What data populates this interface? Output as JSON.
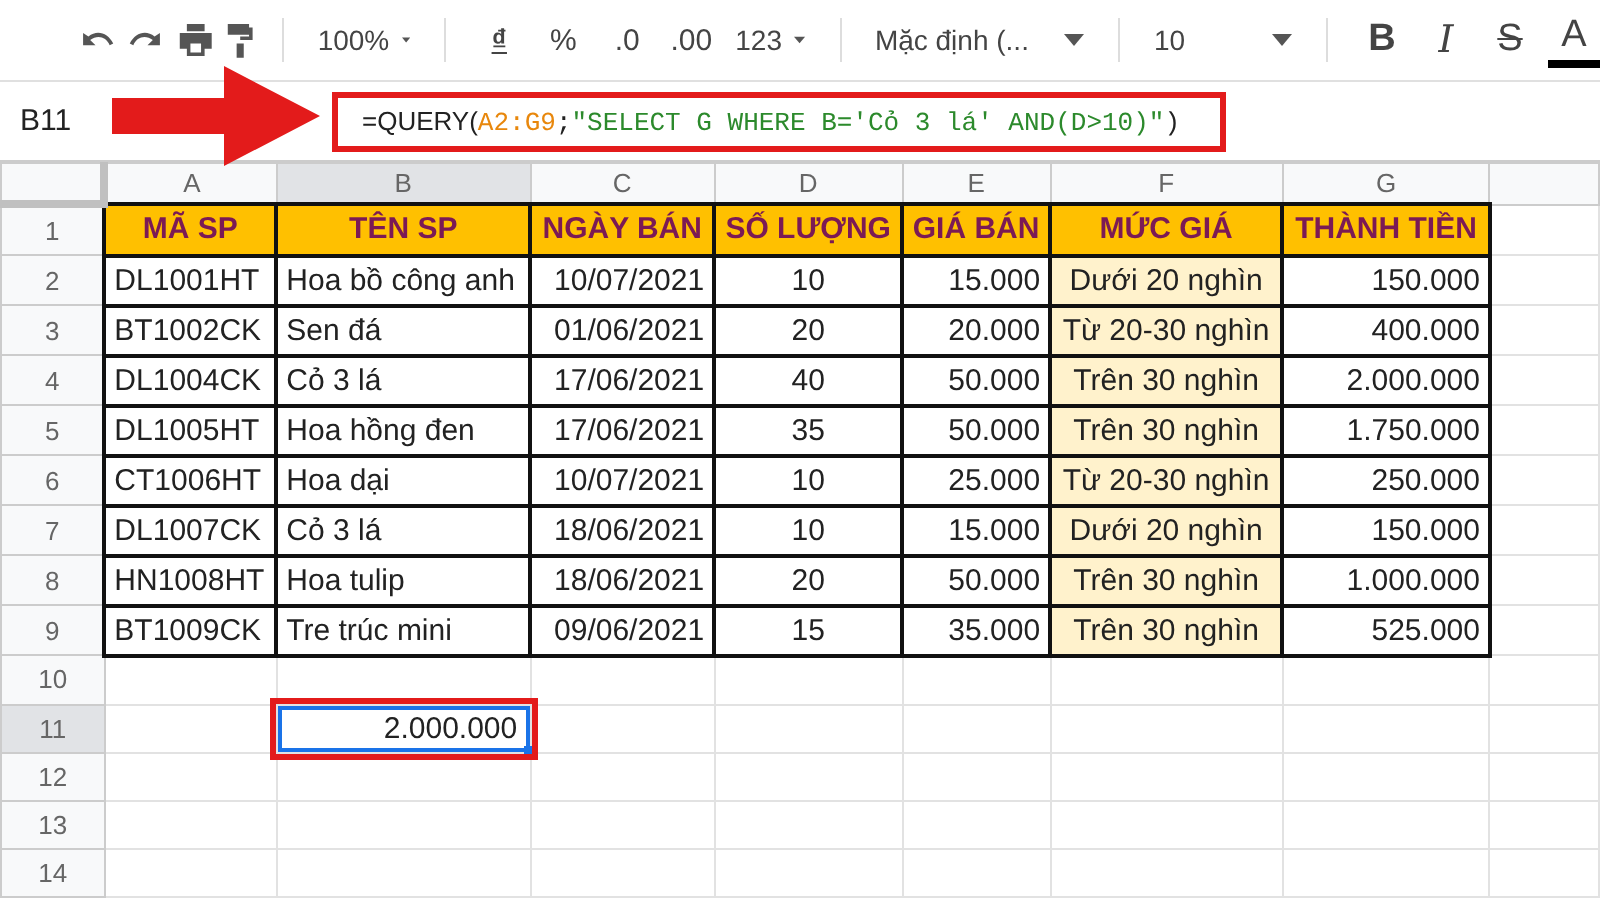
{
  "toolbar": {
    "zoom": "100%",
    "currency": "₫",
    "percent": "%",
    "decrease_decimals": ".0",
    "increase_decimals": ".00",
    "number_format": "123",
    "font": "Mặc định (...",
    "font_size": "10",
    "bold": "B",
    "italic": "I",
    "strikethrough": "S",
    "text_color": "A"
  },
  "formula_bar": {
    "name_box": "B11",
    "formula": [
      {
        "kind": "function",
        "text": "=QUERY("
      },
      {
        "kind": "range",
        "text": "A2:G9"
      },
      {
        "kind": "plain",
        "text": ";"
      },
      {
        "kind": "string",
        "text": "\"SELECT G WHERE B='Cỏ 3 lá' AND(D>10)\""
      },
      {
        "kind": "plain",
        "text": ")"
      }
    ]
  },
  "sheet": {
    "columns": [
      {
        "label": "A",
        "active": false
      },
      {
        "label": "B",
        "active": true
      },
      {
        "label": "C",
        "active": false
      },
      {
        "label": "D",
        "active": false
      },
      {
        "label": "E",
        "active": false
      },
      {
        "label": "F",
        "active": false
      },
      {
        "label": "G",
        "active": false
      }
    ],
    "rows": [
      {
        "number": "1",
        "kind": "header",
        "active": false,
        "cells": [
          "MÃ SP",
          "TÊN SP",
          "NGÀY BÁN",
          "SỐ LƯỢNG",
          "GIÁ BÁN",
          "MỨC GIÁ",
          "THÀNH TIỀN"
        ]
      },
      {
        "number": "2",
        "kind": "data",
        "active": false,
        "cells": [
          "DL1001HT",
          "Hoa bồ công anh",
          "10/07/2021",
          "10",
          "15.000",
          "Dưới 20 nghìn",
          "150.000"
        ]
      },
      {
        "number": "3",
        "kind": "data",
        "active": false,
        "cells": [
          "BT1002CK",
          "Sen đá",
          "01/06/2021",
          "20",
          "20.000",
          "Từ 20-30 nghìn",
          "400.000"
        ]
      },
      {
        "number": "4",
        "kind": "data",
        "active": false,
        "cells": [
          "DL1004CK",
          "Cỏ 3 lá",
          "17/06/2021",
          "40",
          "50.000",
          "Trên 30 nghìn",
          "2.000.000"
        ]
      },
      {
        "number": "5",
        "kind": "data",
        "active": false,
        "cells": [
          "DL1005HT",
          "Hoa hồng đen",
          "17/06/2021",
          "35",
          "50.000",
          "Trên 30 nghìn",
          "1.750.000"
        ]
      },
      {
        "number": "6",
        "kind": "data",
        "active": false,
        "cells": [
          "CT1006HT",
          "Hoa dại",
          "10/07/2021",
          "10",
          "25.000",
          "Từ 20-30 nghìn",
          "250.000"
        ]
      },
      {
        "number": "7",
        "kind": "data",
        "active": false,
        "cells": [
          "DL1007CK",
          "Cỏ 3 lá",
          "18/06/2021",
          "10",
          "15.000",
          "Dưới 20 nghìn",
          "150.000"
        ]
      },
      {
        "number": "8",
        "kind": "data",
        "active": false,
        "cells": [
          "HN1008HT",
          "Hoa tulip",
          "18/06/2021",
          "20",
          "50.000",
          "Trên 30 nghìn",
          "1.000.000"
        ]
      },
      {
        "number": "9",
        "kind": "data",
        "active": false,
        "cells": [
          "BT1009CK",
          "Tre trúc mini",
          "09/06/2021",
          "15",
          "35.000",
          "Trên 30 nghìn",
          "525.000"
        ]
      },
      {
        "number": "10",
        "kind": "empty",
        "active": false
      },
      {
        "number": "11",
        "kind": "result",
        "active": true,
        "value": "2.000.000",
        "selected": true
      },
      {
        "number": "12",
        "kind": "empty",
        "active": false
      },
      {
        "number": "13",
        "kind": "empty",
        "active": false
      },
      {
        "number": "14",
        "kind": "empty",
        "active": false
      }
    ]
  }
}
